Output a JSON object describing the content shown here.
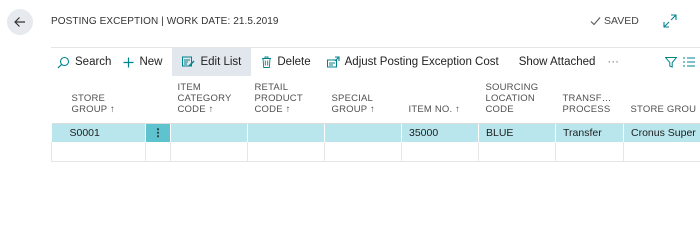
{
  "header": {
    "title": "POSTING EXCEPTION | WORK DATE: 21.5.2019",
    "saved_label": "SAVED",
    "accent": "#00838f"
  },
  "toolbar": {
    "search": "Search",
    "new": "New",
    "edit_list": "Edit List",
    "delete": "Delete",
    "adjust": "Adjust Posting Exception Cost",
    "show_attached": "Show Attached",
    "more": "···"
  },
  "columns": [
    [
      "STORE",
      "GROUP ↑"
    ],
    [
      "ITEM",
      "CATEGORY",
      "CODE ↑"
    ],
    [
      "RETAIL",
      "PRODUCT",
      "CODE ↑"
    ],
    [
      "SPECIAL",
      "GROUP ↑"
    ],
    [
      "ITEM NO. ↑"
    ],
    [
      "SOURCING",
      "LOCATION",
      "CODE"
    ],
    [
      "TRANSF…",
      "PROCESS"
    ],
    [
      "STORE GROU"
    ]
  ],
  "rows": [
    {
      "store_group": "S0001",
      "item_category_code": "",
      "retail_product_code": "",
      "special_group": "",
      "item_no": "35000",
      "sourcing_location_code": "BLUE",
      "transfer_process": "Transfer",
      "store_group_name": "Cronus Super"
    }
  ]
}
